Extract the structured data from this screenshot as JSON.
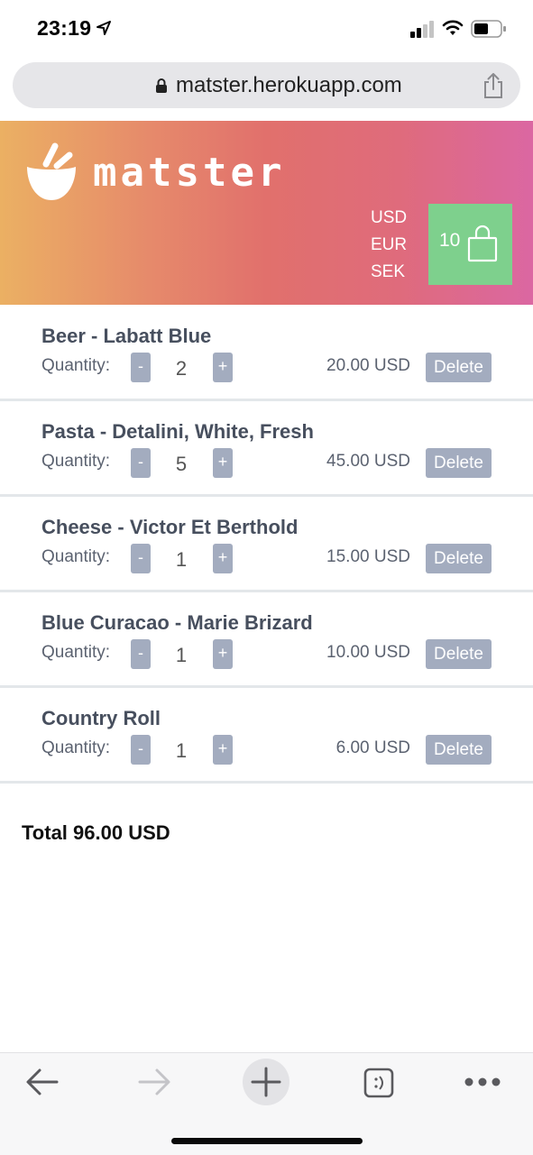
{
  "status_bar": {
    "time": "23:19"
  },
  "browser": {
    "url": "matster.herokuapp.com"
  },
  "header": {
    "brand": "matster",
    "currencies": [
      "USD",
      "EUR",
      "SEK"
    ],
    "cart_count": "10"
  },
  "cart": {
    "quantity_label": "Quantity:",
    "minus_label": "-",
    "plus_label": "+",
    "delete_label": "Delete",
    "items": [
      {
        "name": "Beer - Labatt Blue",
        "quantity": "2",
        "price": "20.00 USD"
      },
      {
        "name": "Pasta - Detalini, White, Fresh",
        "quantity": "5",
        "price": "45.00 USD"
      },
      {
        "name": "Cheese - Victor Et Berthold",
        "quantity": "1",
        "price": "15.00 USD"
      },
      {
        "name": "Blue Curacao - Marie Brizard",
        "quantity": "1",
        "price": "10.00 USD"
      },
      {
        "name": "Country Roll",
        "quantity": "1",
        "price": "6.00 USD"
      }
    ],
    "total": "Total 96.00 USD"
  },
  "colors": {
    "header_gradient": [
      "#ebb063",
      "#e1706c",
      "#db67a2"
    ],
    "cart_button": "#7ed08d",
    "button_gray": "#a3acbf",
    "item_title": "#474f5e"
  },
  "icons": [
    "location-arrow-icon",
    "signal-icon",
    "wifi-icon",
    "battery-icon",
    "lock-icon",
    "share-icon",
    "bowl-logo-icon",
    "shopping-bag-icon",
    "back-arrow-icon",
    "forward-arrow-icon",
    "plus-icon",
    "tabs-icon",
    "more-icon"
  ]
}
